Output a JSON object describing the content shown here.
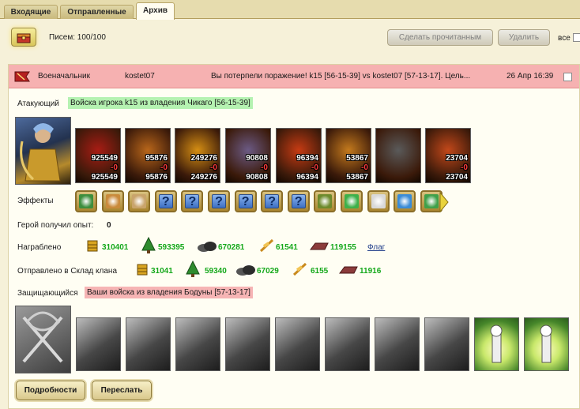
{
  "tabs": [
    "Входящие",
    "Отправленные",
    "Архив"
  ],
  "toolbar": {
    "letters_count": "Писем: 100/100",
    "mark_read": "Сделать прочитанным",
    "delete": "Удалить",
    "all": "все"
  },
  "message": {
    "sender_role": "Военачальник",
    "sender": "kostet07",
    "subject": "Вы потерпели поражение! k15 [56-15-39] vs kostet07 [57-13-17]. Цель...",
    "date": "26 Апр 16:39"
  },
  "attacker": {
    "label": "Атакующий",
    "title": "Войска игрока k15 из владения Чикаго [56-15-39]",
    "units": [
      {
        "top": "925549",
        "loss": "-0",
        "bottom": "925549",
        "color": "#a81c14"
      },
      {
        "top": "95876",
        "loss": "-0",
        "bottom": "95876",
        "color": "#b8661a"
      },
      {
        "top": "249276",
        "loss": "-0",
        "bottom": "249276",
        "color": "#d58e13"
      },
      {
        "top": "90808",
        "loss": "-0",
        "bottom": "90808",
        "color": "#6b5a84"
      },
      {
        "top": "96394",
        "loss": "-0",
        "bottom": "96394",
        "color": "#c63b13"
      },
      {
        "top": "53867",
        "loss": "-0",
        "bottom": "53867",
        "color": "#c47a1d"
      },
      {
        "top": "",
        "loss": "",
        "bottom": "",
        "color": "#5a5a5a"
      },
      {
        "top": "23704",
        "loss": "-0",
        "bottom": "23704",
        "color": "#c2481a"
      }
    ]
  },
  "effects": {
    "label": "Эффекты",
    "items": [
      "sword-effect-icon",
      "handshake-effect-icon",
      "hand-effect-icon",
      "question",
      "question",
      "question",
      "question",
      "question",
      "question",
      "xp-scroll-icon",
      "heal-effect-icon",
      "heart-effect-icon",
      "globe-effect-icon",
      "heart-gift-icon"
    ]
  },
  "hero_exp": {
    "label": "Герой получил опыт:",
    "value": "0"
  },
  "plunder": {
    "label": "Награблено",
    "values": [
      "310401",
      "593395",
      "670281",
      "61541",
      "119155"
    ],
    "flag_link": "Флаг"
  },
  "clan_storage": {
    "label": "Отправлено в Склад клана",
    "values": [
      "31041",
      "59340",
      "67029",
      "6155",
      "11916"
    ]
  },
  "defender": {
    "label": "Защищающийся",
    "title": "Ваши войска из владения Бодуны [57-13-17]"
  },
  "buttons": {
    "details": "Подробности",
    "forward": "Переслать"
  },
  "colors": {
    "header_bg": "#f6b1b1",
    "attacker_bg": "#b5f2b1",
    "defender_bg": "#f6b4b4",
    "resource_value": "#14a81a"
  }
}
